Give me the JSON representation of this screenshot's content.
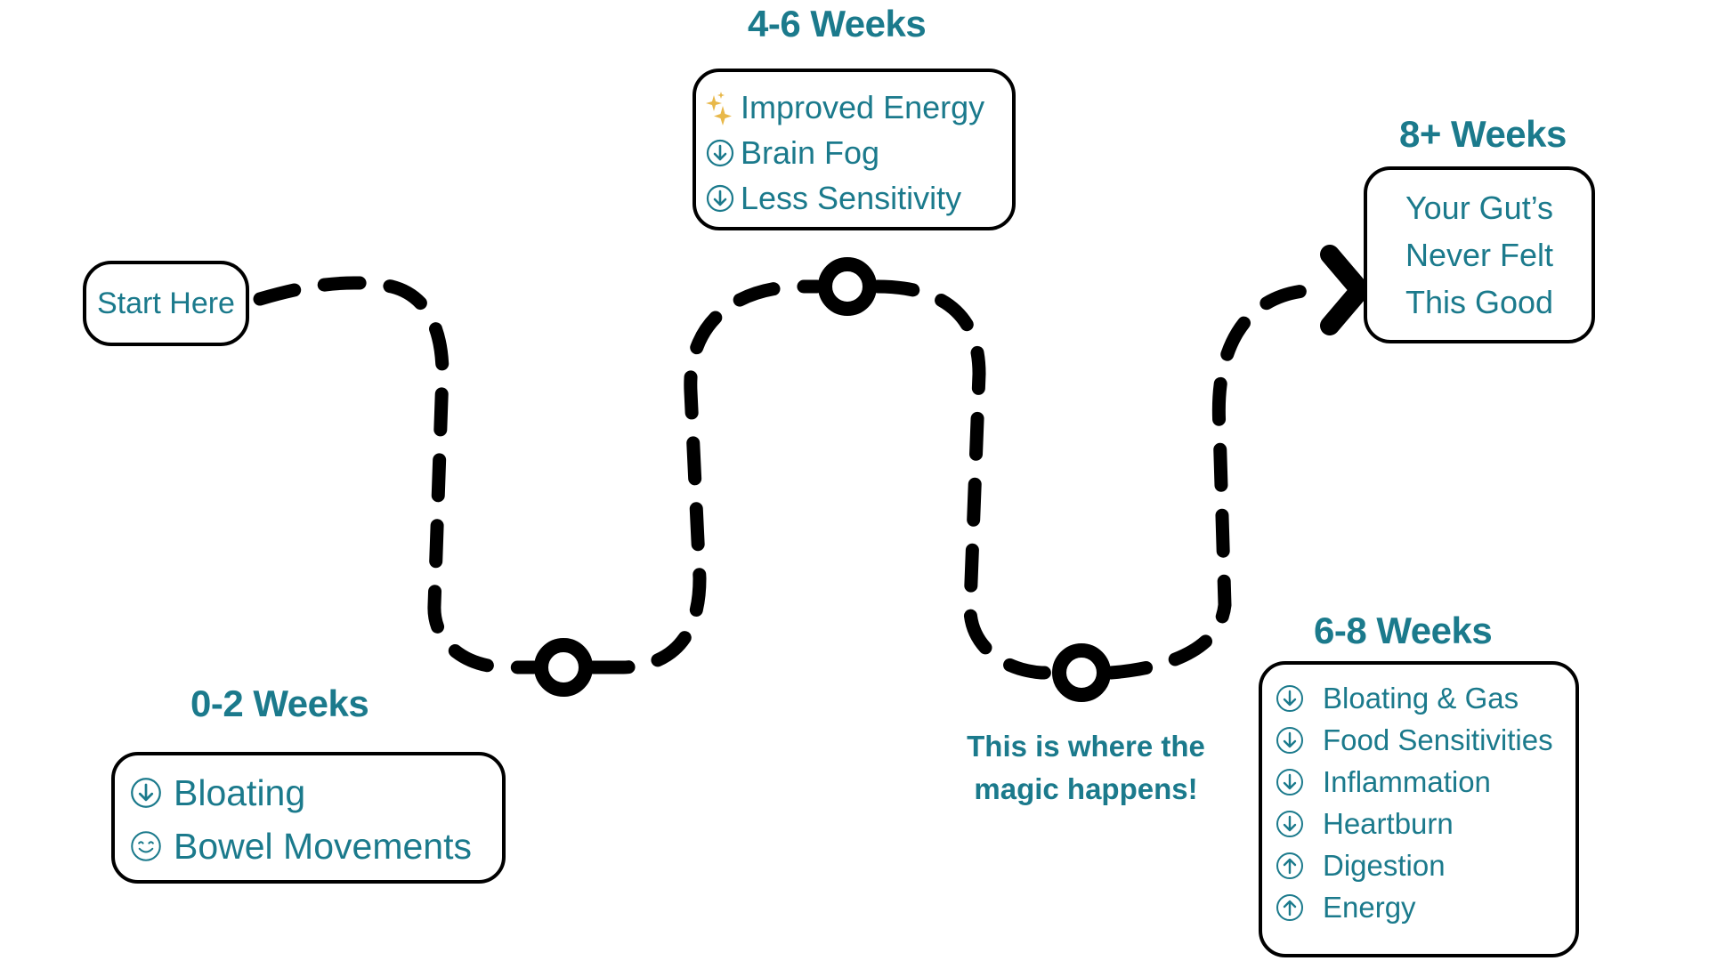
{
  "colors": {
    "accent": "#1b7a8c",
    "line": "#000000",
    "sparkle": "#e8b84a"
  },
  "start": {
    "label": "Start Here"
  },
  "stages": {
    "week_0_2": {
      "title": "0-2 Weeks",
      "items": [
        {
          "icon": "arrow-down-circle-icon",
          "label": "Bloating"
        },
        {
          "icon": "smiley-icon",
          "label": "Bowel Movements"
        }
      ]
    },
    "week_4_6": {
      "title": "4-6 Weeks",
      "items": [
        {
          "icon": "sparkles-icon",
          "label": "Improved Energy"
        },
        {
          "icon": "arrow-down-circle-icon",
          "label": "Brain Fog"
        },
        {
          "icon": "arrow-down-circle-icon",
          "label": "Less Sensitivity"
        }
      ]
    },
    "week_6_8": {
      "title": "6-8 Weeks",
      "items": [
        {
          "icon": "arrow-down-circle-icon",
          "label": "Bloating & Gas"
        },
        {
          "icon": "arrow-down-circle-icon",
          "label": "Food Sensitivities"
        },
        {
          "icon": "arrow-down-circle-icon",
          "label": "Inflammation"
        },
        {
          "icon": "arrow-down-circle-icon",
          "label": "Heartburn"
        },
        {
          "icon": "arrow-up-circle-icon",
          "label": "Digestion"
        },
        {
          "icon": "arrow-up-circle-icon",
          "label": "Energy"
        }
      ]
    },
    "week_8_plus": {
      "title": "8+ Weeks",
      "lines": [
        "Your Gut’s",
        "Never Felt",
        "This Good"
      ]
    }
  },
  "annotation": {
    "lines": [
      "This is where the",
      "magic happens!"
    ]
  }
}
